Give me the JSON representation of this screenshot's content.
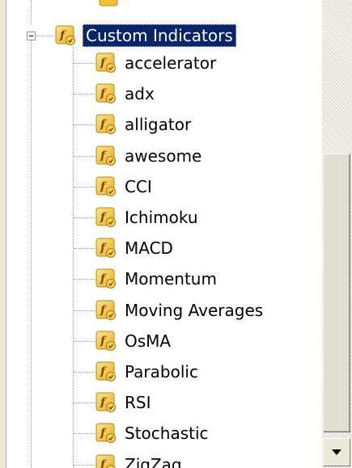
{
  "tree": {
    "root": {
      "label": "Custom Indicators",
      "icon": "custom-indicator-icon",
      "expanded": true
    },
    "items": [
      {
        "label": "accelerator",
        "icon": "custom-indicator-icon"
      },
      {
        "label": "adx",
        "icon": "custom-indicator-icon"
      },
      {
        "label": "alligator",
        "icon": "custom-indicator-icon"
      },
      {
        "label": "awesome",
        "icon": "custom-indicator-icon"
      },
      {
        "label": "CCI",
        "icon": "custom-indicator-icon"
      },
      {
        "label": "Ichimoku",
        "icon": "custom-indicator-icon"
      },
      {
        "label": "MACD",
        "icon": "custom-indicator-icon"
      },
      {
        "label": "Momentum",
        "icon": "custom-indicator-icon"
      },
      {
        "label": "Moving Averages",
        "icon": "custom-indicator-icon"
      },
      {
        "label": "OsMA",
        "icon": "custom-indicator-icon"
      },
      {
        "label": "Parabolic",
        "icon": "custom-indicator-icon"
      },
      {
        "label": "RSI",
        "icon": "custom-indicator-icon"
      },
      {
        "label": "Stochastic",
        "icon": "custom-indicator-icon"
      },
      {
        "label": "ZigZag",
        "icon": "custom-indicator-icon"
      }
    ]
  },
  "colors": {
    "selection_bg": "#0a246a",
    "selection_text": "#ffffff",
    "icon_fill": "#f0c23a",
    "icon_badge": "#e0a020"
  }
}
